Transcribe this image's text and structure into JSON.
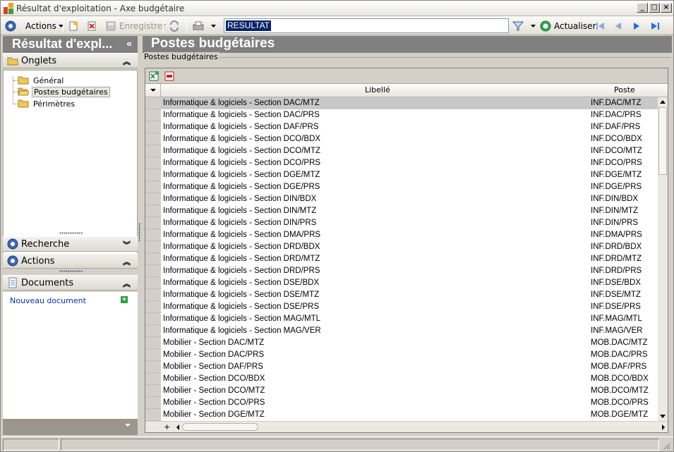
{
  "window": {
    "title": "Résultat d'exploitation - Axe budgétaire",
    "controls": [
      "_",
      "□",
      "×"
    ]
  },
  "toolbar": {
    "actions_label": "Actions",
    "save_label": "Enregistrer",
    "combo_value": "RESULTAT",
    "refresh_label": "Actualiser"
  },
  "left_panel": {
    "header": "Résultat d'expl...",
    "collapse_glyph": "«",
    "sections": {
      "tabs": "Onglets",
      "search": "Recherche",
      "actions": "Actions",
      "documents": "Documents"
    },
    "tree": [
      "Général",
      "Postes budgétaires",
      "Périmètres"
    ],
    "selected_tree_item": "Postes budgétaires",
    "new_document": "Nouveau document"
  },
  "main": {
    "header": "Postes budgétaires",
    "group_label": "Postes budgétaires",
    "columns": {
      "label": "Libellé",
      "code": "Poste"
    },
    "rows": [
      {
        "label": "Informatique & logiciels - Section DAC/MTZ",
        "code": "INF.DAC/MTZ"
      },
      {
        "label": "Informatique & logiciels - Section DAC/PRS",
        "code": "INF.DAC/PRS"
      },
      {
        "label": "Informatique & logiciels - Section DAF/PRS",
        "code": "INF.DAF/PRS"
      },
      {
        "label": "Informatique & logiciels - Section DCO/BDX",
        "code": "INF.DCO/BDX"
      },
      {
        "label": "Informatique & logiciels - Section DCO/MTZ",
        "code": "INF.DCO/MTZ"
      },
      {
        "label": "Informatique & logiciels - Section DCO/PRS",
        "code": "INF.DCO/PRS"
      },
      {
        "label": "Informatique & logiciels - Section DGE/MTZ",
        "code": "INF.DGE/MTZ"
      },
      {
        "label": "Informatique & logiciels - Section DGE/PRS",
        "code": "INF.DGE/PRS"
      },
      {
        "label": "Informatique & logiciels - Section DIN/BDX",
        "code": "INF.DIN/BDX"
      },
      {
        "label": "Informatique & logiciels - Section DIN/MTZ",
        "code": "INF.DIN/MTZ"
      },
      {
        "label": "Informatique & logiciels - Section DIN/PRS",
        "code": "INF.DIN/PRS"
      },
      {
        "label": "Informatique & logiciels - Section DMA/PRS",
        "code": "INF.DMA/PRS"
      },
      {
        "label": "Informatique & logiciels - Section DRD/BDX",
        "code": "INF.DRD/BDX"
      },
      {
        "label": "Informatique & logiciels - Section DRD/MTZ",
        "code": "INF.DRD/MTZ"
      },
      {
        "label": "Informatique & logiciels - Section DRD/PRS",
        "code": "INF.DRD/PRS"
      },
      {
        "label": "Informatique & logiciels - Section DSE/BDX",
        "code": "INF.DSE/BDX"
      },
      {
        "label": "Informatique & logiciels - Section DSE/MTZ",
        "code": "INF.DSE/MTZ"
      },
      {
        "label": "Informatique & logiciels - Section DSE/PRS",
        "code": "INF.DSE/PRS"
      },
      {
        "label": "Informatique & logiciels - Section MAG/MTL",
        "code": "INF.MAG/MTL"
      },
      {
        "label": "Informatique & logiciels - Section MAG/VER",
        "code": "INF.MAG/VER"
      },
      {
        "label": "Mobilier - Section DAC/MTZ",
        "code": "MOB.DAC/MTZ"
      },
      {
        "label": "Mobilier - Section DAC/PRS",
        "code": "MOB.DAC/PRS"
      },
      {
        "label": "Mobilier - Section DAF/PRS",
        "code": "MOB.DAF/PRS"
      },
      {
        "label": "Mobilier - Section DCO/BDX",
        "code": "MOB.DCO/BDX"
      },
      {
        "label": "Mobilier - Section DCO/MTZ",
        "code": "MOB.DCO/MTZ"
      },
      {
        "label": "Mobilier - Section DCO/PRS",
        "code": "MOB.DCO/PRS"
      },
      {
        "label": "Mobilier - Section DGE/MTZ",
        "code": "MOB.DGE/MTZ"
      }
    ],
    "active_row": 0
  },
  "colors": {
    "header_bg": "#808080",
    "selection_bg": "#0a246a",
    "link": "#0033aa",
    "active_row": "#c8c8c8"
  }
}
